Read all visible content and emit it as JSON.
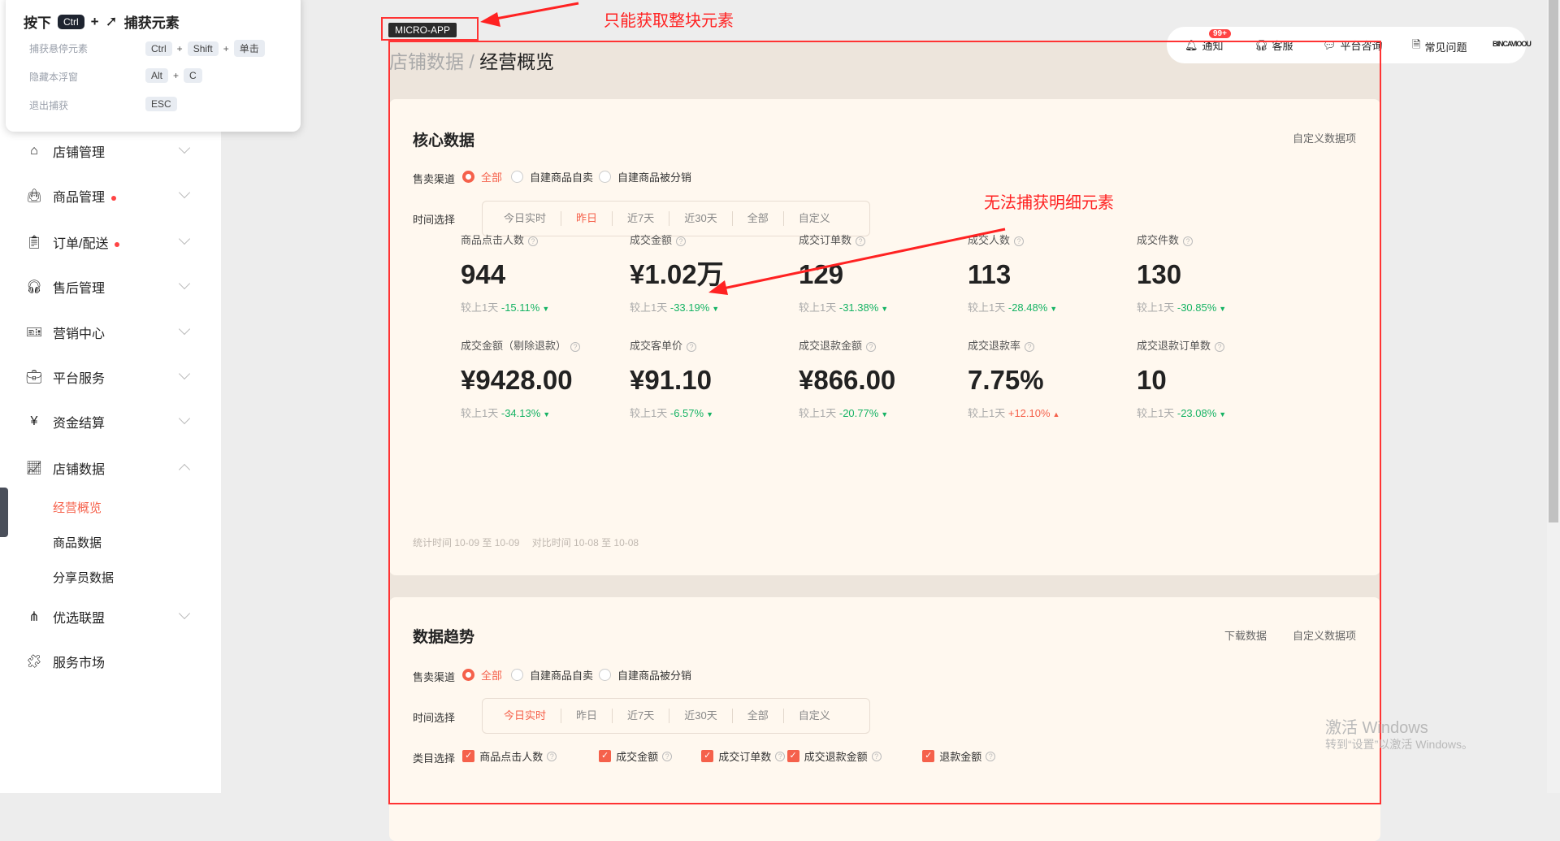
{
  "popup": {
    "title_pre": "按下",
    "title_key": "Ctrl",
    "title_plus": "+",
    "title_post": "捕获元素",
    "rows": [
      {
        "label": "捕获悬停元素",
        "keys": [
          "Ctrl",
          "Shift",
          "单击"
        ]
      },
      {
        "label": "隐藏本浮窗",
        "keys": [
          "Alt",
          "C"
        ]
      },
      {
        "label": "退出捕获",
        "keys": [
          "ESC"
        ]
      }
    ],
    "plus": "+"
  },
  "sidebar": {
    "items": [
      {
        "label": "店铺管理",
        "icon": "store-icon"
      },
      {
        "label": "商品管理",
        "icon": "bag-icon",
        "dot": true
      },
      {
        "label": "订单/配送",
        "icon": "clipboard-icon",
        "dot": true
      },
      {
        "label": "售后管理",
        "icon": "headset-icon"
      },
      {
        "label": "营销中心",
        "icon": "ticket-icon"
      },
      {
        "label": "平台服务",
        "icon": "briefcase-icon"
      },
      {
        "label": "资金结算",
        "icon": "yen-icon"
      },
      {
        "label": "店铺数据",
        "icon": "chart-icon"
      },
      {
        "label": "优选联盟",
        "icon": "network-icon"
      },
      {
        "label": "服务市场",
        "icon": "puzzle-icon"
      }
    ],
    "sub_items": [
      {
        "label": "经营概览",
        "active": true
      },
      {
        "label": "商品数据"
      },
      {
        "label": "分享员数据"
      }
    ]
  },
  "micro_app_tag": "MICRO-APP",
  "annotations": {
    "a1": "只能获取整块元素",
    "a2": "无法捕获明细元素"
  },
  "breadcrumb": {
    "parent": "店铺数据",
    "sep": "/",
    "current": "经营概览"
  },
  "topbar": {
    "notice": "通知",
    "badge": "99+",
    "service": "客服",
    "consult": "平台咨询",
    "faq": "常见问题",
    "brand": "BINCAVIOOU"
  },
  "core": {
    "title": "核心数据",
    "custom": "自定义数据项",
    "channel_label": "售卖渠道",
    "channels": [
      "全部",
      "自建商品自卖",
      "自建商品被分销"
    ],
    "time_label": "时间选择",
    "times": [
      "今日实时",
      "昨日",
      "近7天",
      "近30天",
      "全部",
      "自定义"
    ],
    "compare_prefix": "较上1天",
    "metrics": [
      {
        "label": "商品点击人数",
        "value": "944",
        "change": "-15.11%",
        "dir": "down"
      },
      {
        "label": "成交金额",
        "value": "¥1.02万",
        "change": "-33.19%",
        "dir": "down"
      },
      {
        "label": "成交订单数",
        "value": "129",
        "change": "-31.38%",
        "dir": "down"
      },
      {
        "label": "成交人数",
        "value": "113",
        "change": "-28.48%",
        "dir": "down"
      },
      {
        "label": "成交件数",
        "value": "130",
        "change": "-30.85%",
        "dir": "down"
      },
      {
        "label": "成交金额（剔除退款）",
        "value": "¥9428.00",
        "change": "-34.13%",
        "dir": "down"
      },
      {
        "label": "成交客单价",
        "value": "¥91.10",
        "change": "-6.57%",
        "dir": "down"
      },
      {
        "label": "成交退款金额",
        "value": "¥866.00",
        "change": "-20.77%",
        "dir": "down"
      },
      {
        "label": "成交退款率",
        "value": "7.75%",
        "change": "+12.10%",
        "dir": "up"
      },
      {
        "label": "成交退款订单数",
        "value": "10",
        "change": "-23.08%",
        "dir": "down"
      }
    ],
    "footer": "统计时间 10-09 至 10-09　 对比时间 10-08 至 10-08"
  },
  "trend": {
    "title": "数据趋势",
    "download": "下载数据",
    "custom": "自定义数据项",
    "channel_label": "售卖渠道",
    "channels": [
      "全部",
      "自建商品自卖",
      "自建商品被分销"
    ],
    "time_label": "时间选择",
    "times": [
      "今日实时",
      "昨日",
      "近7天",
      "近30天",
      "全部",
      "自定义"
    ],
    "category_label": "类目选择",
    "categories": [
      "商品点击人数",
      "成交金额",
      "成交订单数",
      "成交退款金额",
      "退款金额"
    ]
  },
  "watermark": {
    "line1": "激活 Windows",
    "line2": "转到“设置”以激活 Windows。"
  },
  "colors": {
    "accent": "#f5614b",
    "down": "#16b364",
    "annotation": "#ff2222"
  }
}
